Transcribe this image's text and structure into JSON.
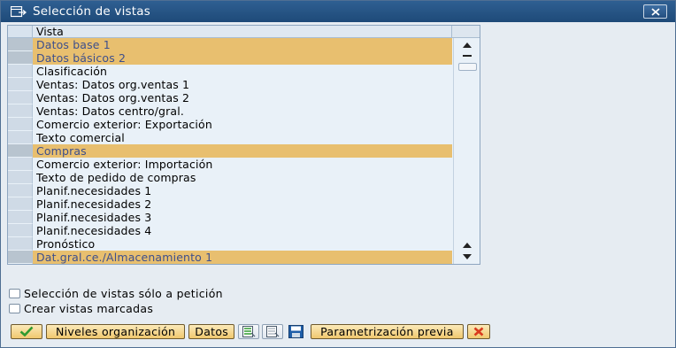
{
  "dialog": {
    "title": "Selección de vistas"
  },
  "table": {
    "column_header": "Vista",
    "rows": [
      {
        "label": "Datos base 1",
        "selected": true
      },
      {
        "label": "Datos básicos 2",
        "selected": true
      },
      {
        "label": "Clasificación",
        "selected": false
      },
      {
        "label": "Ventas: Datos org.ventas 1",
        "selected": false
      },
      {
        "label": "Ventas: Datos org.ventas 2",
        "selected": false
      },
      {
        "label": "Ventas: Datos centro/gral.",
        "selected": false
      },
      {
        "label": "Comercio exterior: Exportación",
        "selected": false
      },
      {
        "label": "Texto comercial",
        "selected": false
      },
      {
        "label": "Compras",
        "selected": true
      },
      {
        "label": "Comercio exterior: Importación",
        "selected": false
      },
      {
        "label": "Texto de pedido de compras",
        "selected": false
      },
      {
        "label": "Planif.necesidades 1",
        "selected": false
      },
      {
        "label": "Planif.necesidades 2",
        "selected": false
      },
      {
        "label": "Planif.necesidades 3",
        "selected": false
      },
      {
        "label": "Planif.necesidades 4",
        "selected": false
      },
      {
        "label": "Pronóstico",
        "selected": false
      },
      {
        "label": "Dat.gral.ce./Almacenamiento 1",
        "selected": true
      }
    ]
  },
  "options": {
    "only_on_request": {
      "label": "Selección de vistas sólo a petición",
      "checked": false
    },
    "create_marked": {
      "label": "Crear vistas marcadas",
      "checked": false
    }
  },
  "toolbar": {
    "org_levels_label": "Niveles organización",
    "data_label": "Datos",
    "default_values_label": "Parametrización previa"
  },
  "colors": {
    "title_bar": "#1e4a78",
    "selected_row": "#e8bf6f",
    "button": "#f0c86f",
    "confirm_green": "#2f9a2f",
    "cancel_red": "#d93a1e"
  }
}
